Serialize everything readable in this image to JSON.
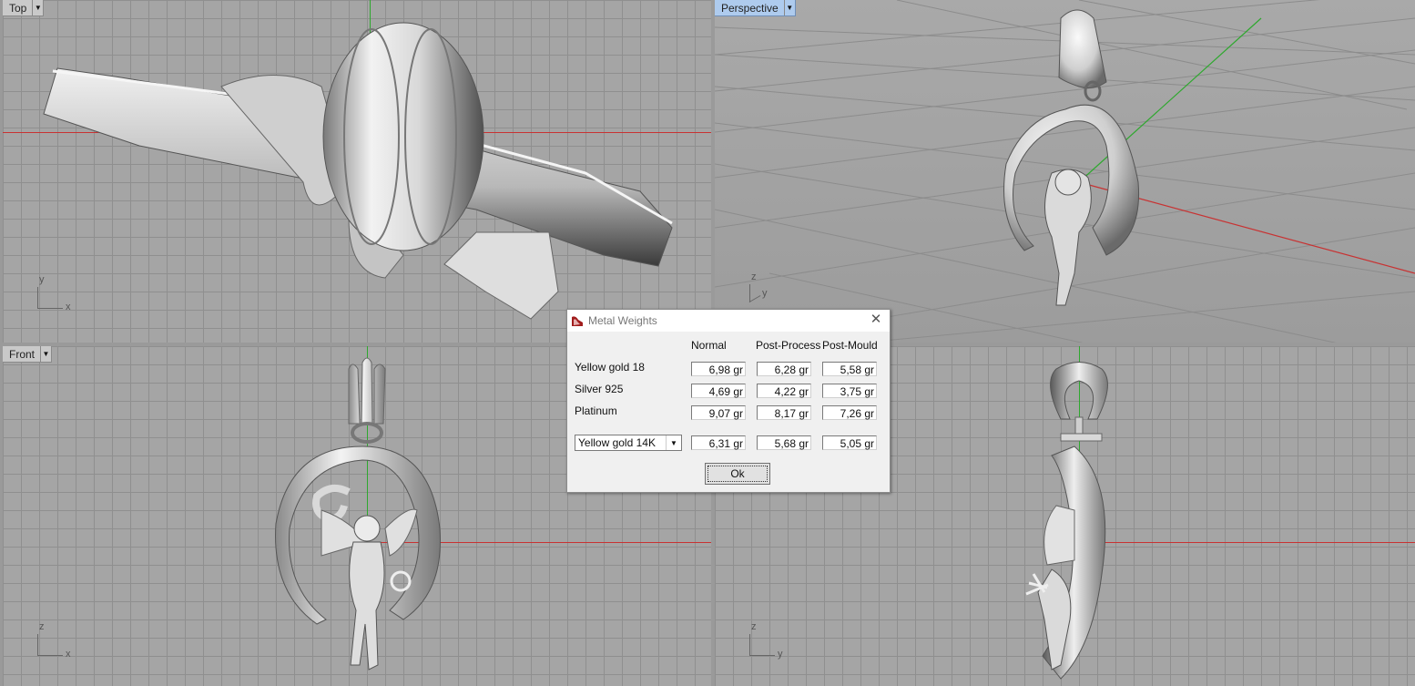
{
  "viewports": {
    "top": {
      "label": "Top",
      "triad_up": "y",
      "triad_right": "x"
    },
    "perspective": {
      "label": "Perspective",
      "triad_up": "z",
      "triad_right": "y"
    },
    "front": {
      "label": "Front",
      "triad_up": "z",
      "triad_right": "x"
    },
    "right": {
      "triad_up": "z",
      "triad_right": "y"
    }
  },
  "colors": {
    "x_axis": "#c83232",
    "y_axis": "#2ea82e",
    "active_label": "#aecbee",
    "model": "#e6e6e6"
  },
  "dialog": {
    "title": "Metal Weights",
    "icon": "rhino-app-icon",
    "columns": [
      "Normal",
      "Post-Process",
      "Post-Mould"
    ],
    "rows": [
      {
        "label": "Yellow gold 18",
        "values": [
          "6,98 gr",
          "6,28 gr",
          "5,58 gr"
        ]
      },
      {
        "label": "Silver 925",
        "values": [
          "4,69 gr",
          "4,22 gr",
          "3,75 gr"
        ]
      },
      {
        "label": "Platinum",
        "values": [
          "9,07 gr",
          "8,17 gr",
          "7,26 gr"
        ]
      }
    ],
    "custom": {
      "selected": "Yellow gold 14K",
      "values": [
        "6,31 gr",
        "5,68 gr",
        "5,05 gr"
      ]
    },
    "ok_label": "Ok"
  }
}
